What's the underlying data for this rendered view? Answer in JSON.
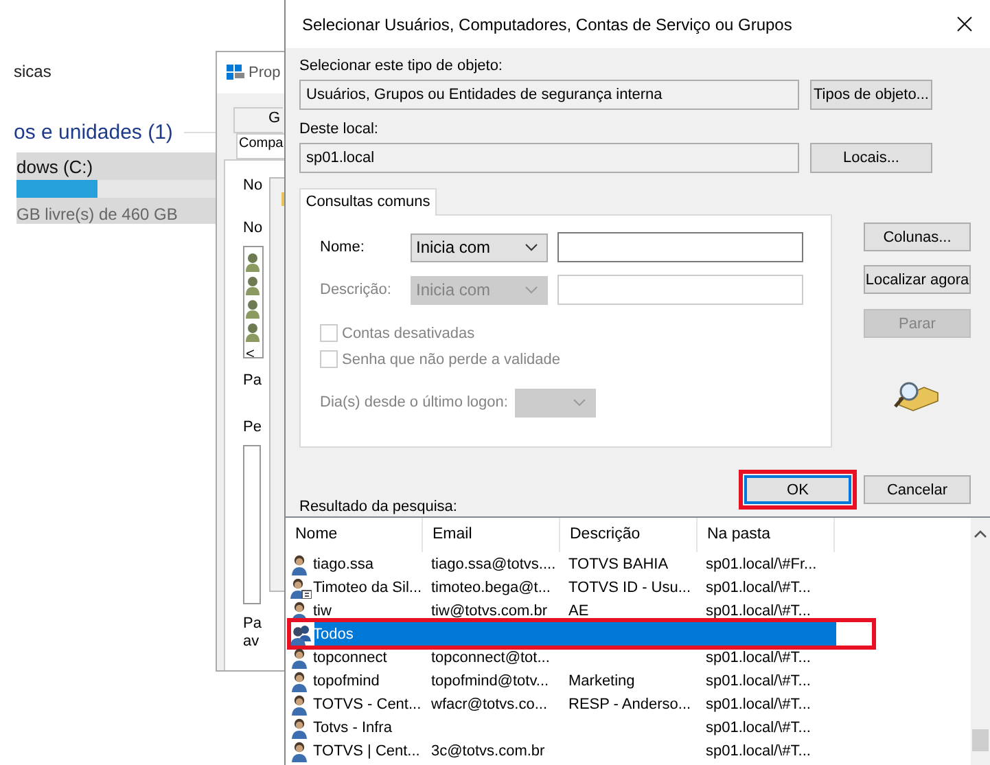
{
  "background_explorer": {
    "heading_fragment": "sicas",
    "section_title": "os e unidades (1)",
    "drive": {
      "name": "dows (C:)",
      "level": 0.41,
      "free_space": "GB livre(s) de 460 GB"
    }
  },
  "properties_window": {
    "title": "Prop",
    "tabs": [
      {
        "label": "G",
        "selected": false
      },
      {
        "label": "Compa",
        "selected": true
      }
    ],
    "texts": [
      "No",
      "No",
      "Pa",
      "Pe",
      "Pa",
      "av"
    ],
    "scroll_left": "<"
  },
  "dialog": {
    "title": "Selecionar Usuários, Computadores, Contas de Serviço ou Grupos",
    "object_type": {
      "label": "Selecionar este tipo de objeto:",
      "value": "Usuários, Grupos ou Entidades de segurança interna",
      "button": "Tipos de objeto..."
    },
    "location": {
      "label": "Deste local:",
      "value": "sp01.local",
      "button": "Locais..."
    },
    "query_tab": {
      "label": "Consultas comuns",
      "selected": true
    },
    "filters": [
      {
        "label": "Nome:",
        "mode": "Inicia com",
        "disabled": false
      },
      {
        "label": "Descrição:",
        "mode": "Inicia com",
        "disabled": true
      }
    ],
    "checkboxes": [
      {
        "label": "Contas desativadas",
        "checked": false,
        "disabled": true
      },
      {
        "label": "Senha que não perde a validade",
        "checked": false,
        "disabled": true
      }
    ],
    "last_logon": {
      "label": "Dia(s) desde o último logon:",
      "disabled": true
    },
    "side_buttons": [
      {
        "label": "Colunas...",
        "disabled": false
      },
      {
        "label": "Localizar agora",
        "disabled": false
      },
      {
        "label": "Parar",
        "disabled": true
      }
    ],
    "ok_button": {
      "label": "OK",
      "default": true,
      "highlighted": true
    },
    "cancel_button": {
      "label": "Cancelar"
    },
    "results": {
      "label": "Resultado da pesquisa:",
      "columns": [
        "Nome",
        "Email",
        "Descrição",
        "Na pasta"
      ],
      "rows": [
        {
          "kind": "user",
          "name": "tiago.ssa",
          "email": "tiago.ssa@totvs....",
          "description": "TOTVS BAHIA",
          "folder": "sp01.local/\\#Fr...",
          "selected": false,
          "highlighted": false
        },
        {
          "kind": "contact",
          "name": "Timoteo da Sil...",
          "email": "timoteo.bega@t...",
          "description": "TOTVS ID - Usu...",
          "folder": "sp01.local/\\#T...",
          "selected": false,
          "highlighted": false
        },
        {
          "kind": "user",
          "name": "tiw",
          "email": "tiw@totvs.com.br",
          "description": "AE",
          "folder": "sp01.local/\\#T...",
          "selected": false,
          "highlighted": false
        },
        {
          "kind": "group",
          "name": "Todos",
          "selected": true,
          "highlighted": true
        },
        {
          "kind": "user",
          "name": "topconnect",
          "email": "topconnect@tot...",
          "folder": "sp01.local/\\#T...",
          "selected": false,
          "highlighted": false
        },
        {
          "kind": "user",
          "name": "topofmind",
          "email": "topofmind@totv...",
          "description": "Marketing",
          "folder": "sp01.local/\\#T...",
          "selected": false,
          "highlighted": false
        },
        {
          "kind": "user",
          "name": "TOTVS - Cent...",
          "email": "wfacr@totvs.co...",
          "description": "RESP - Anderso...",
          "folder": "sp01.local/\\#T...",
          "selected": false,
          "highlighted": false
        },
        {
          "kind": "user",
          "name": "Totvs - Infra",
          "folder": "sp01.local/\\#T...",
          "selected": false,
          "highlighted": false
        },
        {
          "kind": "user",
          "name": "TOTVS | Cent...",
          "email": "3c@totvs.com.br",
          "folder": "sp01.local/\\#T...",
          "selected": false,
          "highlighted": false
        }
      ]
    }
  }
}
